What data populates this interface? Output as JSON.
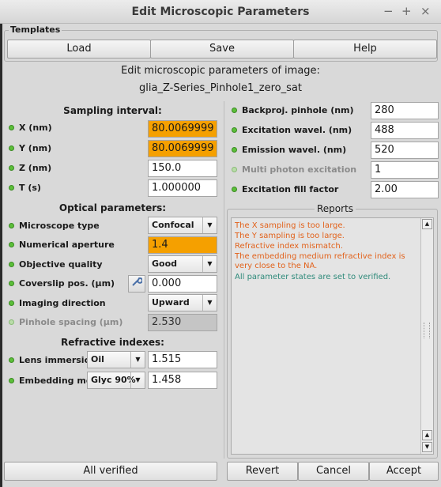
{
  "window": {
    "title": "Edit Microscopic Parameters",
    "minimize": "−",
    "maximize": "+",
    "close": "×"
  },
  "templates": {
    "label": "Templates",
    "load": "Load",
    "save": "Save",
    "help": "Help"
  },
  "heading": {
    "line1": "Edit microscopic parameters of image:",
    "line2": "glia_Z-Series_Pinhole1_zero_sat"
  },
  "sampling": {
    "title": "Sampling interval:",
    "x_label": "X (nm)",
    "x_value": "80.0069999",
    "y_label": "Y (nm)",
    "y_value": "80.0069999",
    "z_label": "Z (nm)",
    "z_value": "150.0",
    "t_label": "T (s)",
    "t_value": "1.000000"
  },
  "optical": {
    "title": "Optical parameters:",
    "mtype_label": "Microscope type",
    "mtype_value": "Confocal",
    "na_label": "Numerical aperture",
    "na_value": "1.4",
    "oq_label": "Objective quality",
    "oq_value": "Good",
    "cs_label": "Coverslip pos. (µm)",
    "cs_value": "0.000",
    "id_label": "Imaging direction",
    "id_value": "Upward",
    "ps_label": "Pinhole spacing (µm)",
    "ps_value": "2.530"
  },
  "refractive": {
    "title": "Refractive indexes:",
    "li_label": "Lens immersion",
    "li_medium": "Oil",
    "li_value": "1.515",
    "em_label": "Embedding med.",
    "em_medium": "Glyc 90%",
    "em_value": "1.458"
  },
  "right": {
    "bp_label": "Backproj. pinhole (nm)",
    "bp_value": "280",
    "ex_label": "Excitation wavel. (nm)",
    "ex_value": "488",
    "emw_label": "Emission wavel. (nm)",
    "emw_value": "520",
    "mp_label": "Multi photon excitation",
    "mp_value": "1",
    "ef_label": "Excitation fill factor",
    "ef_value": "2.00"
  },
  "reports": {
    "title": "Reports",
    "lines": [
      "The X sampling is too large.",
      "The Y sampling is too large.",
      "Refractive index mismatch.",
      "The embedding medium refractive index is very close to the NA.",
      "All parameter states are set to verified."
    ]
  },
  "footer": {
    "all_verified": "All verified",
    "revert": "Revert",
    "cancel": "Cancel",
    "accept": "Accept"
  },
  "colors": {
    "warning_field": "#f5a000",
    "report_warning": "#e2621b",
    "report_ok": "#2e8a7a",
    "status_dot": "#5cbf3a"
  },
  "icons": {
    "coverslip_tool": "wrench-icon",
    "combo_arrow": "chevron-down-icon"
  }
}
